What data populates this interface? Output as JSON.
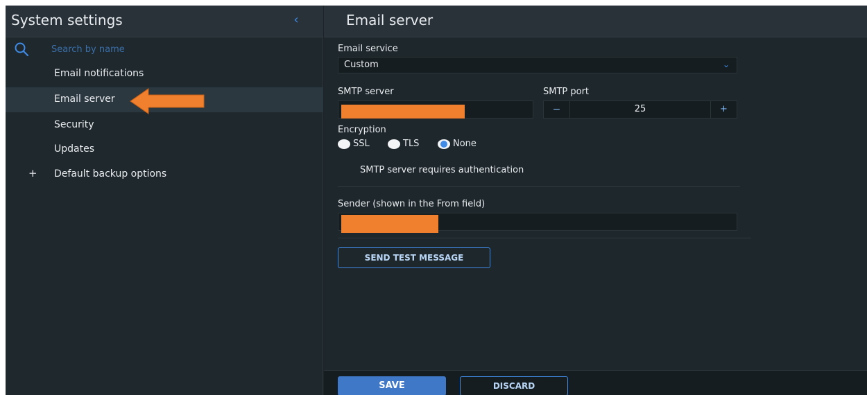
{
  "sidebar": {
    "title": "System settings",
    "collapse_icon": "chevron-left-icon",
    "search": {
      "placeholder": "Search by name",
      "value": ""
    },
    "items": [
      {
        "label": "Email notifications"
      },
      {
        "label": "Email server",
        "active": true
      },
      {
        "label": "Security"
      },
      {
        "label": "Updates"
      },
      {
        "label": "Default backup options",
        "expand": "+"
      }
    ]
  },
  "main": {
    "title": "Email server",
    "email_service": {
      "label": "Email service",
      "value": "Custom"
    },
    "smtp_server": {
      "label": "SMTP server",
      "value": ""
    },
    "smtp_port": {
      "label": "SMTP port",
      "value": "25",
      "minus": "−",
      "plus": "+"
    },
    "encryption": {
      "label": "Encryption",
      "options": [
        "SSL",
        "TLS",
        "None"
      ],
      "selected": "None"
    },
    "auth_text": "SMTP server requires authentication",
    "sender": {
      "label": "Sender (shown in the From field)",
      "value": ""
    },
    "send_test_label": "SEND TEST MESSAGE"
  },
  "footer": {
    "save_label": "SAVE",
    "discard_label": "DISCARD"
  },
  "colors": {
    "accent": "#3f8be6",
    "annotation": "#f07f2e",
    "background": "#1e272c"
  }
}
